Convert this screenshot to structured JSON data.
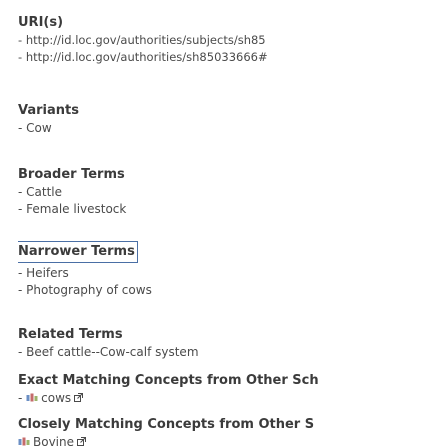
{
  "uris": {
    "heading": "URI(s)",
    "items": [
      "http://id.loc.gov/authorities/subjects/sh85",
      "http://id.loc.gov/authorities/sh85033666#"
    ]
  },
  "variants": {
    "heading": "Variants",
    "items": [
      "Cow"
    ]
  },
  "broader_terms": {
    "heading": "Broader Terms",
    "items": [
      "Cattle",
      "Female livestock"
    ]
  },
  "narrower_terms": {
    "heading": "Narrower Terms",
    "items": [
      "Heifers",
      "Photography of cows"
    ]
  },
  "related_terms": {
    "heading": "Related Terms",
    "items": [
      "Beef cattle--Cow-calf system"
    ]
  },
  "exact_matching": {
    "heading": "Exact Matching Concepts from Other Sch",
    "items": [
      "cows"
    ]
  },
  "close_matching": {
    "heading": "Closely Matching Concepts from Other S",
    "items": [
      "Bovine"
    ]
  },
  "dash": "- "
}
